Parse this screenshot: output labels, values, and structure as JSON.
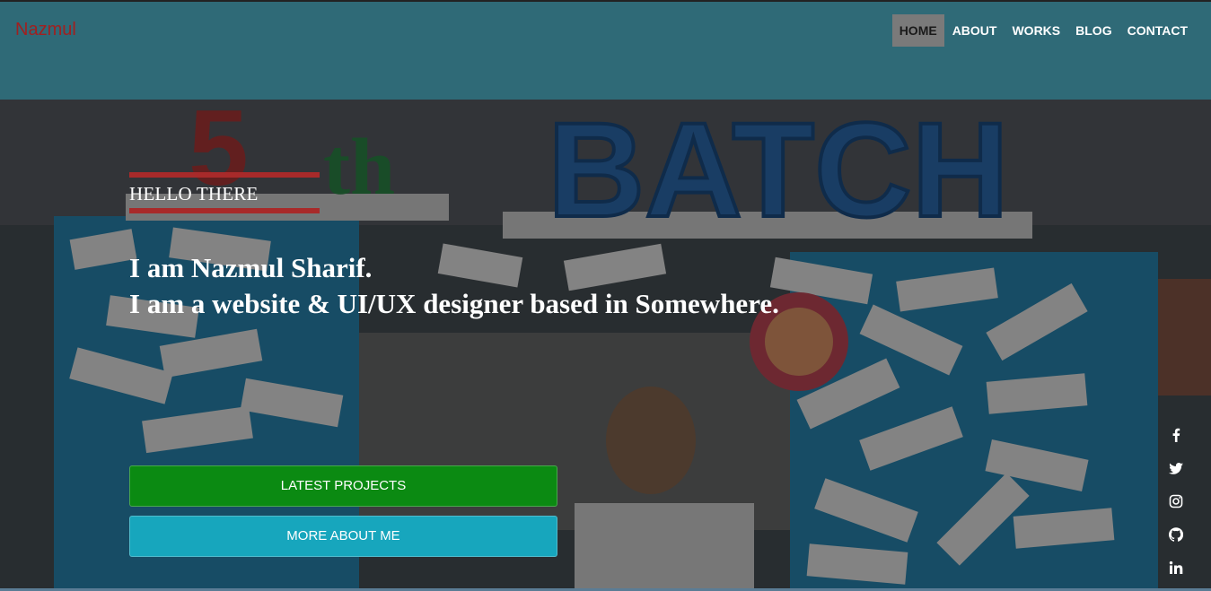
{
  "header": {
    "brand": "Nazmul",
    "nav": [
      {
        "label": "HOME",
        "active": true
      },
      {
        "label": "ABOUT",
        "active": false
      },
      {
        "label": "WORKS",
        "active": false
      },
      {
        "label": "BLOG",
        "active": false
      },
      {
        "label": "CONTACT",
        "active": false
      }
    ]
  },
  "hero": {
    "greeting": "HELLO THERE",
    "line1": "I am Nazmul Sharif.",
    "line2": "I am a website & UI/UX designer based in Somewhere.",
    "primary_button": "LATEST PROJECTS",
    "secondary_button": "MORE ABOUT ME"
  },
  "social": {
    "icons": [
      "facebook-icon",
      "twitter-icon",
      "instagram-icon",
      "github-icon",
      "linkedin-icon"
    ]
  },
  "colors": {
    "header_bg": "#2f6a77",
    "brand": "#a02020",
    "active_nav": "#7a7a7a",
    "accent_rule": "#a82a2a",
    "primary_button": "#0b8a12",
    "secondary_button": "#17a6bd"
  }
}
